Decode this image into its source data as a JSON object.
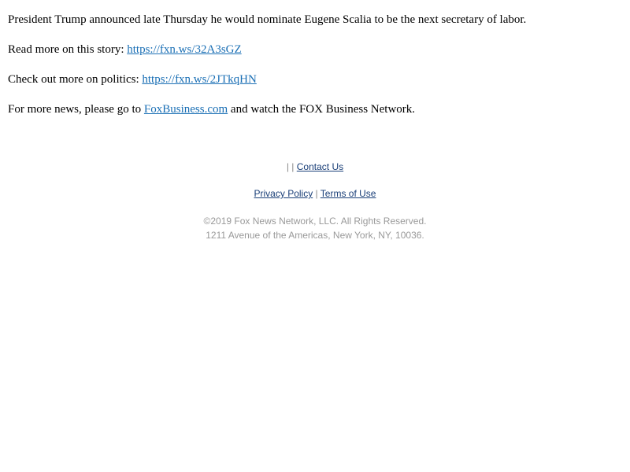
{
  "article": {
    "para1": "President Trump announced late Thursday he would nominate Eugene Scalia to be the next secretary of labor.",
    "para2_prefix": "Read more on this story: ",
    "para2_link": "https://fxn.ws/32A3sGZ",
    "para3_prefix": "Check out more on politics: ",
    "para3_link": "https://fxn.ws/2JTkqHN",
    "para4_prefix": "For more news, please go to ",
    "para4_link": "FoxBusiness.com",
    "para4_suffix": " and watch the FOX Business Network."
  },
  "footer": {
    "sep_top": "| | ",
    "contact_label": "Contact Us",
    "privacy_label": "Privacy Policy",
    "sep_mid": " | ",
    "terms_label": "Terms of Use",
    "copyright": "©2019 Fox News Network, LLC. All Rights Reserved.",
    "address": "1211 Avenue of the Americas, New York, NY, 10036."
  },
  "colors": {
    "link": "#1a6fb5",
    "footer_link": "#1a3f78",
    "footer_muted": "#999999"
  }
}
